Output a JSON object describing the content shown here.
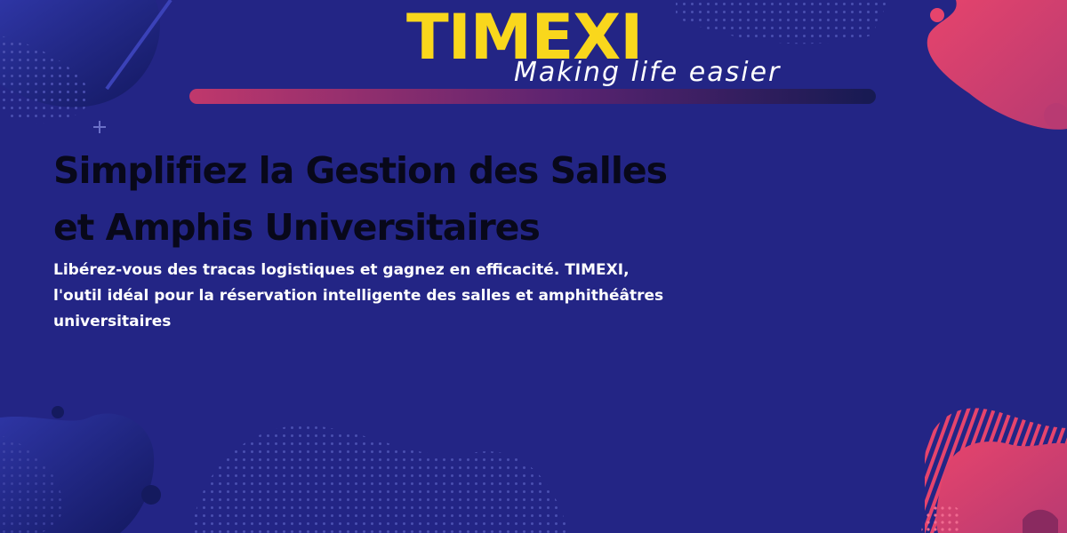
{
  "brand": {
    "name": "TIMEXI",
    "tagline": "Making life easier"
  },
  "hero": {
    "headline_line1": "Simplifiez la Gestion des Salles",
    "headline_line2": "et Amphis Universitaires",
    "subtitle_line1": "Libérez-vous des tracas logistiques et gagnez en efficacité. TIMEXI,",
    "subtitle_line2": "l'outil idéal pour la réservation intelligente des salles et amphithéâtres",
    "subtitle_line3": "universitaires"
  },
  "colors": {
    "background": "#232585",
    "brand_yellow": "#f9d71c",
    "headline_dark": "#08081a",
    "accent_pink": "#e6446c",
    "accent_magenta": "#c0386c",
    "accent_navy": "#141a5e"
  }
}
